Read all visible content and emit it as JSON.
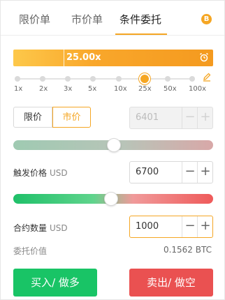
{
  "tabs": [
    {
      "label": "限价单"
    },
    {
      "label": "市价单"
    },
    {
      "label": "条件委托"
    }
  ],
  "active_tab": "条件委托",
  "info_badge": "B",
  "leverage": {
    "value_label": "25.00x",
    "ticks": [
      "1x",
      "2x",
      "3x",
      "5x",
      "10x",
      "25x",
      "50x",
      "100x"
    ],
    "selected": "25x"
  },
  "price_type": {
    "limit_label": "限价",
    "market_label": "市价",
    "selected": "市价"
  },
  "price_input": {
    "value": "6401"
  },
  "trigger": {
    "label": "触发价格",
    "unit": "USD",
    "value": "6700",
    "slider_fraction": 0.5
  },
  "quantity": {
    "label": "合约数量",
    "unit": "USD",
    "value": "1000",
    "slider_fraction": 0.5
  },
  "order_value": {
    "label": "委托价值",
    "value": "0.1562 BTC"
  },
  "buttons": {
    "buy": "买入/ 做多",
    "sell": "卖出/ 做空"
  },
  "steppers": {
    "minus": "−",
    "plus": "+"
  },
  "colors": {
    "accent": "#f5a623",
    "buy": "#19c466",
    "sell": "#ea5151"
  }
}
